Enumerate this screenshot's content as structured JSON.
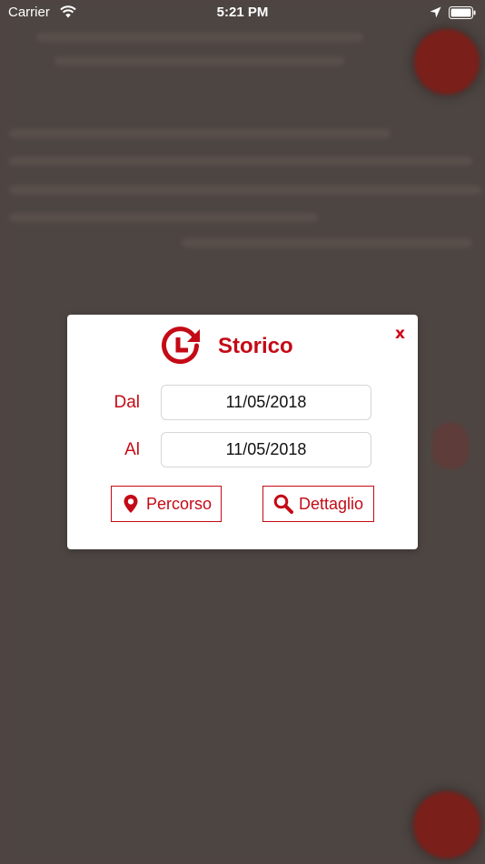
{
  "status_bar": {
    "carrier": "Carrier",
    "time": "5:21 PM"
  },
  "modal": {
    "title": "Storico",
    "close_label": "x",
    "from_label": "Dal",
    "from_value": "11/05/2018",
    "to_label": "Al",
    "to_value": "11/05/2018",
    "route_button_label": "Percorso",
    "detail_button_label": "Dettaglio"
  },
  "icons": {
    "history": "history-clock-icon",
    "route": "map-pin-icon",
    "detail": "magnifier-icon"
  },
  "colors": {
    "accent": "#c40a16",
    "overlay": "#4f4643",
    "modal_bg": "#ffffff"
  }
}
